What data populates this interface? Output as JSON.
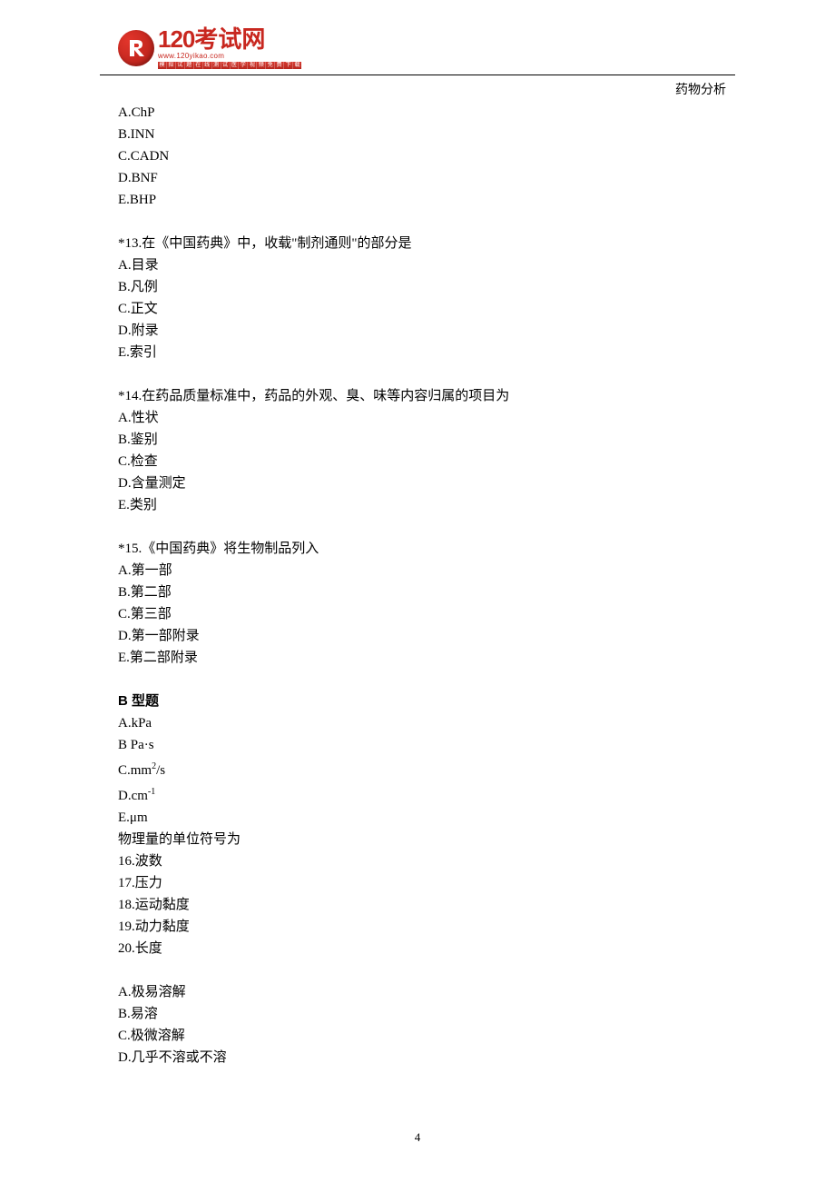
{
  "logo": {
    "main": "120考试网",
    "sub": "www.120yikao.com",
    "strip": [
      "模",
      "拟",
      "试",
      "题",
      "在",
      "线",
      "测",
      "试",
      "医",
      "学",
      "视",
      "频",
      "免",
      "费",
      "下",
      "载"
    ]
  },
  "header": {
    "subject": "药物分析"
  },
  "page_number": "4",
  "q12_options": {
    "a": "A.ChP",
    "b": "B.INN",
    "c": "C.CADN",
    "d": "D.BNF",
    "e": "E.BHP"
  },
  "q13": {
    "stem": "*13.在《中国药典》中，收载\"制剂通则\"的部分是",
    "a": "A.目录",
    "b": "B.凡例",
    "c": "C.正文",
    "d": "D.附录",
    "e": "E.索引"
  },
  "q14": {
    "stem": "*14.在药品质量标准中，药品的外观、臭、味等内容归属的项目为",
    "a": "A.性状",
    "b": "B.鉴别",
    "c": "C.检查",
    "d": "D.含量测定",
    "e": "E.类别"
  },
  "q15": {
    "stem": "*15.《中国药典》将生物制品列入",
    "a": "A.第一部",
    "b": "B.第二部",
    "c": "C.第三部",
    "d": "D.第一部附录",
    "e": "E.第二部附录"
  },
  "typeB": {
    "heading": "B 型题",
    "opts": {
      "a": "A.kPa",
      "b": "B Pa·s",
      "c_pre": "C.mm",
      "c_sup": "2",
      "c_post": "/s",
      "d_pre": "D.cm",
      "d_sup": "-1",
      "e": "E.μm"
    },
    "intro": "物理量的单位符号为",
    "items": {
      "i16": "16.波数",
      "i17": "17.压力",
      "i18": "18.运动黏度",
      "i19": "19.动力黏度",
      "i20": "20.长度"
    },
    "opts2": {
      "a": "A.极易溶解",
      "b": "B.易溶",
      "c": "C.极微溶解",
      "d": "D.几乎不溶或不溶"
    }
  }
}
